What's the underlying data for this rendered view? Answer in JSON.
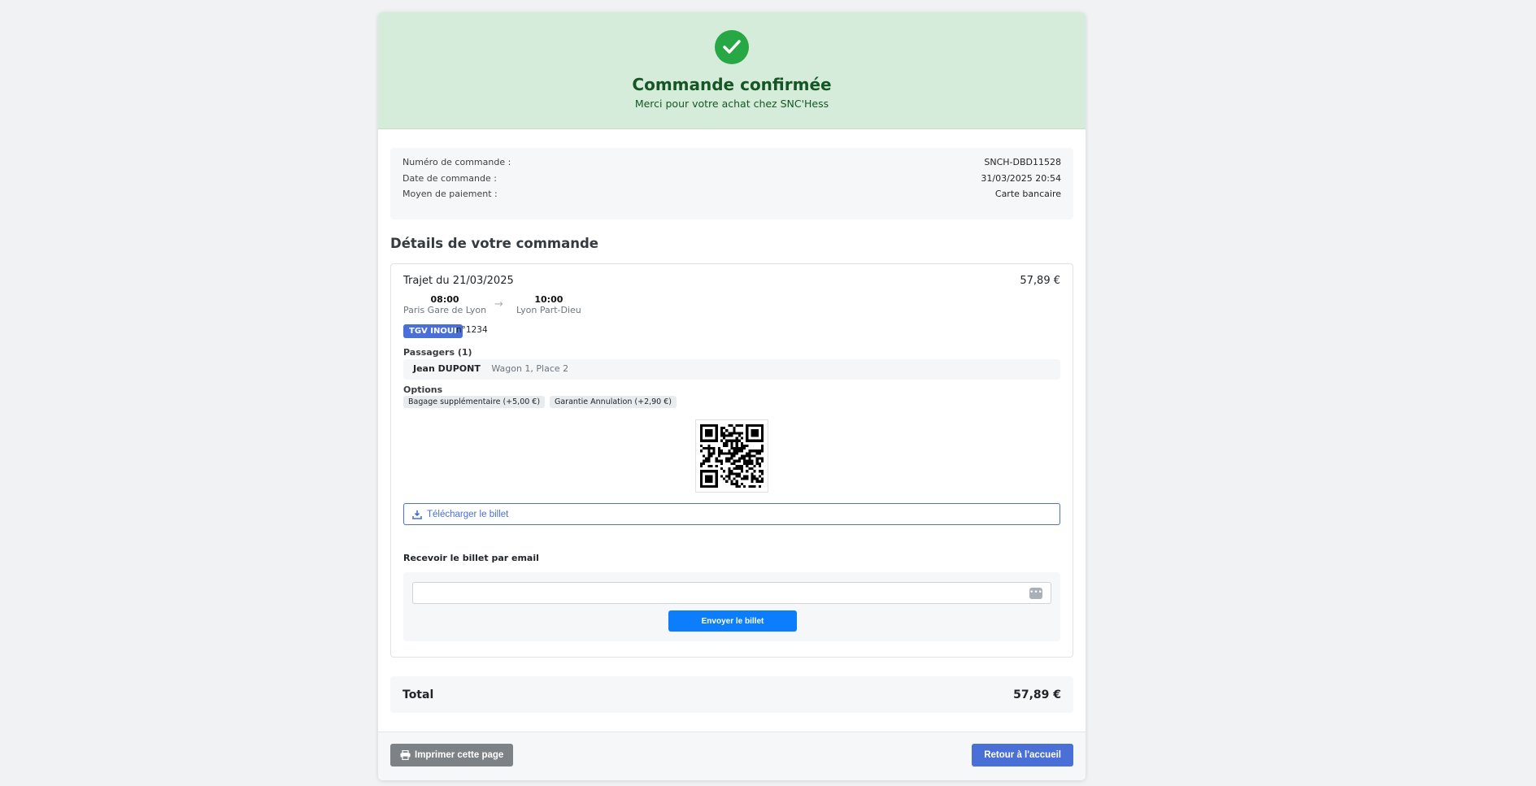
{
  "header": {
    "title": "Commande confirmée",
    "subtitle": "Merci pour votre achat chez SNC'Hess"
  },
  "order_info": [
    {
      "label": "Numéro de commande :",
      "value": "SNCH-DBD11528"
    },
    {
      "label": "Date de commande :",
      "value": "31/03/2025 20:54"
    },
    {
      "label": "Moyen de paiement :",
      "value": "Carte bancaire"
    }
  ],
  "details_title": "Détails de votre commande",
  "trip": {
    "title": "Trajet du 21/03/2025",
    "price": "57,89 €",
    "departure": {
      "time": "08:00",
      "station": "Paris Gare de Lyon"
    },
    "arrival": {
      "time": "10:00",
      "station": "Lyon Part-Dieu"
    },
    "arrow": "→",
    "train_type": "TGV INOUI",
    "train_number": "n°1234",
    "passengers_title": "Passagers (1)",
    "passenger": {
      "name": "Jean DUPONT",
      "seat": "Wagon 1, Place 2"
    },
    "options_title": "Options",
    "options": [
      "Bagage supplémentaire (+5,00 €)",
      "Garantie Annulation (+2,90 €)"
    ],
    "download_label": "Télécharger le billet"
  },
  "email": {
    "title": "Recevoir le billet par email",
    "input_value": "",
    "send_label": "Envoyer le billet"
  },
  "total": {
    "label": "Total",
    "value": "57,89 €"
  },
  "footer": {
    "print_label": "Imprimer cette page",
    "home_label": "Retour à l'accueil"
  },
  "colors": {
    "success": "#28a745",
    "primary": "#4a6fd6",
    "send": "#0d7efb"
  }
}
